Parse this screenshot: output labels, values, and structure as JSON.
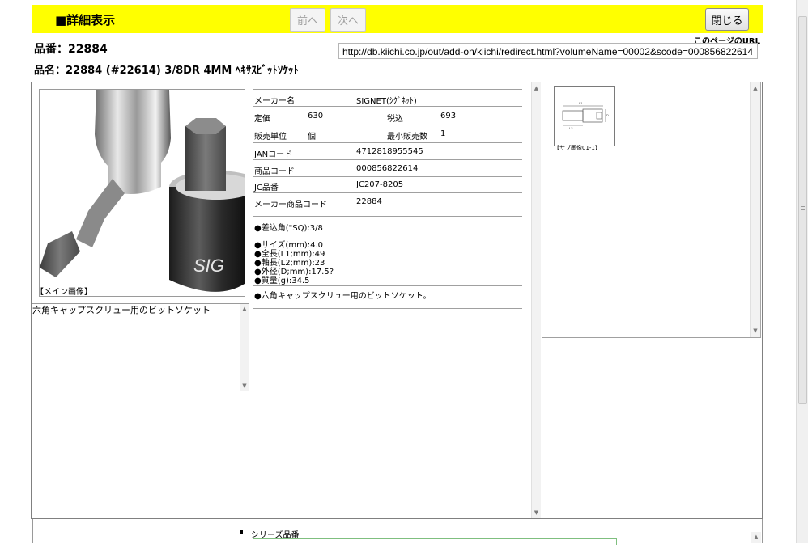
{
  "header": {
    "title": "■詳細表示",
    "prev_label": "前へ",
    "next_label": "次へ",
    "close_label": "閉じる"
  },
  "product": {
    "hinban": "品番：22884",
    "hinmei": "品名：22884 (#22614) 3/8DR 4MM ﾍｷｻｽﾋﾞｯﾄｿｹｯﾄ"
  },
  "page_url": {
    "label": "このページのURL",
    "value": "http://db.kiichi.co.jp/out/add-on/kiichi/redirect.html?volumeName=00002&scode=000856822614"
  },
  "main_image": {
    "caption": "【メイン画像】"
  },
  "description_box": {
    "text": "六角キャップスクリュー用のビットソケット"
  },
  "specs": {
    "maker_label": "メーカー名",
    "maker_value": "SIGNET(ｼｸﾞﾈｯﾄ)",
    "list_price_label": "定価",
    "list_price_value": "630",
    "tax_incl_label": "税込",
    "tax_incl_value": "693",
    "unit_label": "販売単位",
    "unit_value": "個",
    "min_qty_label": "最小販売数",
    "min_qty_value": "1",
    "jan_label": "JANコード",
    "jan_value": "4712818955545",
    "product_code_label": "商品コード",
    "product_code_value": "000856822614",
    "jc_label": "JC品番",
    "jc_value": "JC207-8205",
    "maker_code_label": "メーカー商品コード",
    "maker_code_value": "22884",
    "drive": "●差込角(\"SQ):3/8",
    "details": [
      "●サイズ(mm):4.0",
      "●全長(L1;mm):49",
      "●軸長(L2;mm):23",
      "●外径(D;mm):17.5?",
      "●質量(g):34.5"
    ],
    "feature": "●六角キャップスクリュー用のビットソケット。"
  },
  "sub_image": {
    "caption": "【サブ画像01-1】"
  },
  "series": {
    "label": "シリーズ品番"
  }
}
